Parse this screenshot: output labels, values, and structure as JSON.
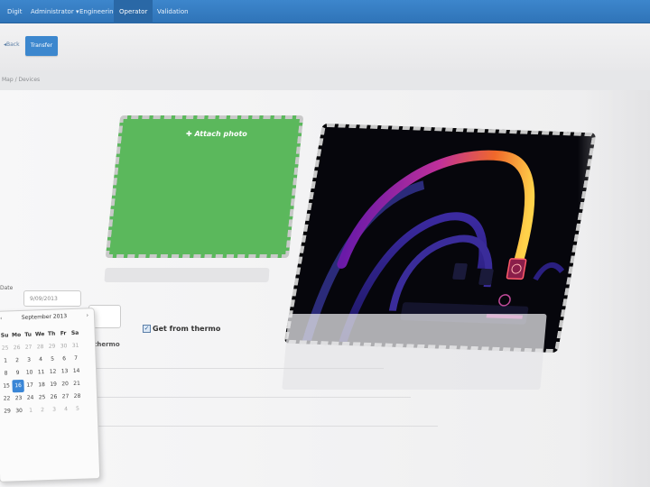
{
  "navbar": {
    "items": [
      {
        "label": "Digit",
        "active": false
      },
      {
        "label": "Administrator ▾",
        "active": false
      },
      {
        "label": "Engineering",
        "active": false
      },
      {
        "label": "Operator",
        "active": true
      },
      {
        "label": "Validation",
        "active": false
      }
    ]
  },
  "toolbar": {
    "back_label": "◂Back",
    "transfer_label": "Transfer"
  },
  "breadcrumb": {
    "text": "Map / Devices"
  },
  "photo_panel": {
    "attach_label": "Attach photo",
    "attach_icon": "plus-icon",
    "drop_color": "#5bb85c"
  },
  "form": {
    "date_label": "Date",
    "date_value": "9/09/2013",
    "get_from_thermo_label": "Get from thermo",
    "get_from_thermo_checked": true,
    "thermo_label": "thermo"
  },
  "calendar": {
    "month_label": "September 2013",
    "prev": "‹",
    "next": "›",
    "dow": [
      "Su",
      "Mo",
      "Tu",
      "We",
      "Th",
      "Fr",
      "Sa"
    ],
    "weeks": [
      [
        {
          "d": "25",
          "m": true
        },
        {
          "d": "26",
          "m": true
        },
        {
          "d": "27",
          "m": true
        },
        {
          "d": "28",
          "m": true
        },
        {
          "d": "29",
          "m": true
        },
        {
          "d": "30",
          "m": true
        },
        {
          "d": "31",
          "m": true
        }
      ],
      [
        {
          "d": "1"
        },
        {
          "d": "2"
        },
        {
          "d": "3"
        },
        {
          "d": "4"
        },
        {
          "d": "5"
        },
        {
          "d": "6"
        },
        {
          "d": "7"
        }
      ],
      [
        {
          "d": "8"
        },
        {
          "d": "9"
        },
        {
          "d": "10"
        },
        {
          "d": "11"
        },
        {
          "d": "12"
        },
        {
          "d": "13"
        },
        {
          "d": "14"
        }
      ],
      [
        {
          "d": "15"
        },
        {
          "d": "16",
          "sel": true
        },
        {
          "d": "17"
        },
        {
          "d": "18"
        },
        {
          "d": "19"
        },
        {
          "d": "20"
        },
        {
          "d": "21"
        }
      ],
      [
        {
          "d": "22"
        },
        {
          "d": "23"
        },
        {
          "d": "24"
        },
        {
          "d": "25"
        },
        {
          "d": "26"
        },
        {
          "d": "27"
        },
        {
          "d": "28"
        }
      ],
      [
        {
          "d": "29"
        },
        {
          "d": "30"
        },
        {
          "d": "1",
          "m": true
        },
        {
          "d": "2",
          "m": true
        },
        {
          "d": "3",
          "m": true
        },
        {
          "d": "4",
          "m": true
        },
        {
          "d": "5",
          "m": true
        }
      ]
    ]
  },
  "colors": {
    "accent": "#3c87ce",
    "navbar": "#2f74b8",
    "selected_day": "#3a86d6"
  }
}
